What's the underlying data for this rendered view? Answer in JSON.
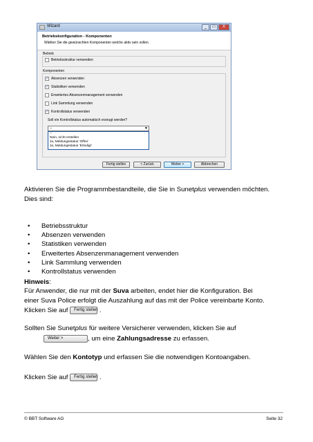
{
  "wizard": {
    "title": "Wizard",
    "window_buttons": [
      "_",
      "□",
      "X"
    ],
    "header_title": "Betriebskonfiguration - Komponenten",
    "header_subtitle": "Wählen Sie die gewünschten Komponenten welche aktiv sein sollen.",
    "group_betrieb": "Betrieb",
    "betriebsstruktur": {
      "label": "Betriebsstruktur verwenden",
      "checked": false
    },
    "group_komponenten": "Komponenten",
    "components": [
      {
        "label": "Absenzen verwenden",
        "checked": true
      },
      {
        "label": "Statistiken verwenden",
        "checked": true
      },
      {
        "label": "Erweitertes Absenzenmanagement verwenden",
        "checked": false
      },
      {
        "label": "Link Sammlung verwenden",
        "checked": false
      },
      {
        "label": "Kontrollstatus verwenden",
        "checked": true
      }
    ],
    "question": "Soll ein Kontrollstatus automatisch erzeugt werden?",
    "combo_value": "--",
    "dropdown_options": [
      "--",
      "Nein, nicht erstellen",
      "Ja, Meldungsstatus 'Offen'",
      "Ja, Meldungsstatus 'Erledigt'"
    ],
    "buttons": {
      "finish": "Fertig stellen",
      "back": "< Zurück",
      "next": "Weiter >",
      "cancel": "Abbrechen"
    }
  },
  "doc": {
    "intro_1a": "Aktivieren Sie die Programmbestandteile, die Sie in Sunet",
    "intro_1b": "plus",
    "intro_1c": " verwenden möchten.",
    "intro_2": "Dies sind:",
    "bullets": [
      "Betriebsstruktur",
      "Absenzen verwenden",
      "Statistiken verwenden",
      "Erweitertes Absenzenmanagement verwenden",
      "Link Sammlung verwenden",
      "Kontrollstatus verwenden"
    ],
    "hinweis": "Hinweis",
    "hinweis_colon": ":",
    "line_a1": "Für Anwender, die nur mit der ",
    "line_a2": "Suva",
    "line_a3": " arbeiten, endet hier die Konfiguration. Bei",
    "line_b": "einer Suva Police erfolgt die Auszahlung auf das mit der Police vereinbarte Konto.",
    "klicken_auf": "Klicken Sie auf",
    "inline_finish": "Fertig stellen",
    "period": ".",
    "line_c1": "Sollten Sie Sunet",
    "line_c2": "plus",
    "line_c3": " für weitere Versicherer verwenden, klicken Sie auf",
    "inline_next": "Weiter >",
    "line_d1": ", um eine ",
    "line_d2": "Zahlungsadresse",
    "line_d3": " zu erfassen.",
    "line_e1": "Wählen Sie den ",
    "line_e2": "Kontotyp",
    "line_e3": " und erfassen Sie die notwendigen Kontoangaben."
  },
  "footer": {
    "left": "© BBT Software AG",
    "right": "Seite 32"
  }
}
